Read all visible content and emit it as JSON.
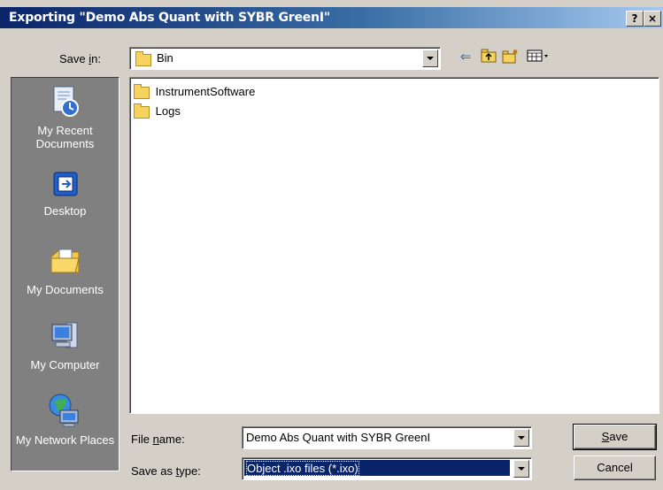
{
  "window": {
    "title": "Exporting \"Demo Abs Quant with SYBR GreenI\"",
    "help_label": "?",
    "close_label": "×"
  },
  "save_in": {
    "label_prefix": "Save ",
    "label_key": "i",
    "label_suffix": "n:",
    "value": "Bin"
  },
  "toolbar": {
    "back_glyph": "⇐",
    "up_glyph": "⤒",
    "new_folder_glyph": "✱",
    "views_glyph": "▦"
  },
  "places": [
    {
      "label": "My Recent Documents",
      "icon": "recent-documents-icon"
    },
    {
      "label": "Desktop",
      "icon": "desktop-icon"
    },
    {
      "label": "My Documents",
      "icon": "my-documents-icon"
    },
    {
      "label": "My Computer",
      "icon": "my-computer-icon"
    },
    {
      "label": "My Network Places",
      "icon": "network-places-icon"
    }
  ],
  "files": [
    {
      "name": "InstrumentSoftware",
      "type": "folder"
    },
    {
      "name": "Logs",
      "type": "folder"
    }
  ],
  "file_name": {
    "label_prefix": "File ",
    "label_key": "n",
    "label_suffix": "ame:",
    "value": "Demo Abs Quant with SYBR GreenI"
  },
  "save_type": {
    "label_prefix": "Save as ",
    "label_key": "t",
    "label_suffix": "ype:",
    "value": "Object .ixo files (*.ixo)"
  },
  "buttons": {
    "save_key": "S",
    "save_rest": "ave",
    "cancel": "Cancel"
  },
  "colors": {
    "title_start": "#0a246a",
    "title_end": "#a6caf0",
    "face": "#d4d0c8",
    "places_bg": "#808080",
    "selection": "#0a246a"
  }
}
